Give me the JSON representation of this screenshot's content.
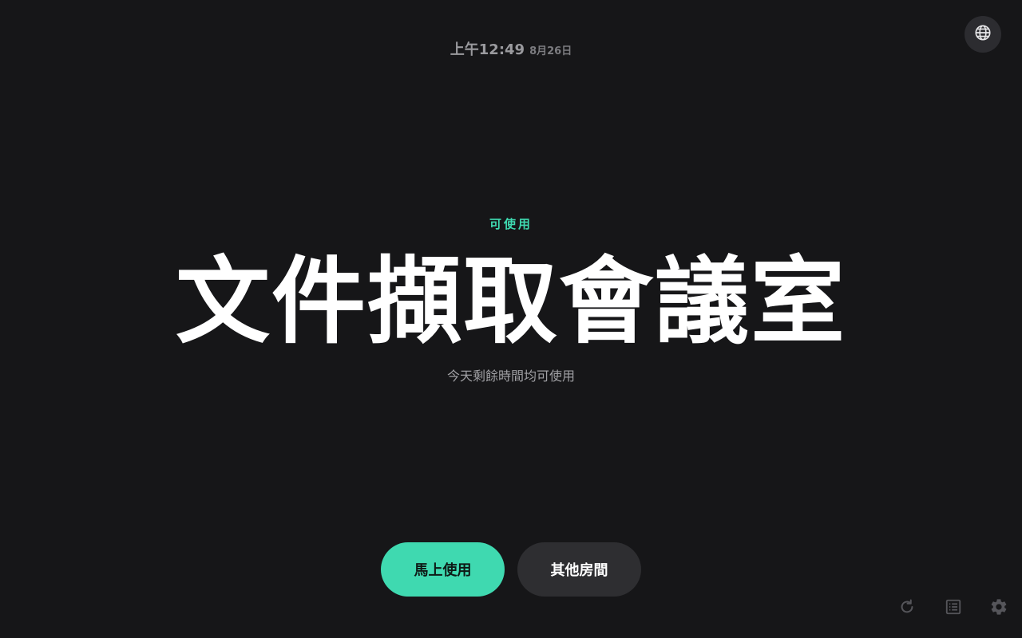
{
  "clock": {
    "time": "上午12:49",
    "date": "8月26日"
  },
  "status": {
    "label": "可使用",
    "color": "#3fd9b0"
  },
  "room": {
    "name": "文件擷取會議室",
    "availability": "今天剩餘時間均可使用"
  },
  "actions": {
    "book_now_label": "馬上使用",
    "book_now_color": "#3fd9b0",
    "other_rooms_label": "其他房間"
  },
  "icons": {
    "language": "globe-icon",
    "refresh": "refresh-icon",
    "schedule": "list-icon",
    "settings": "gear-icon"
  }
}
